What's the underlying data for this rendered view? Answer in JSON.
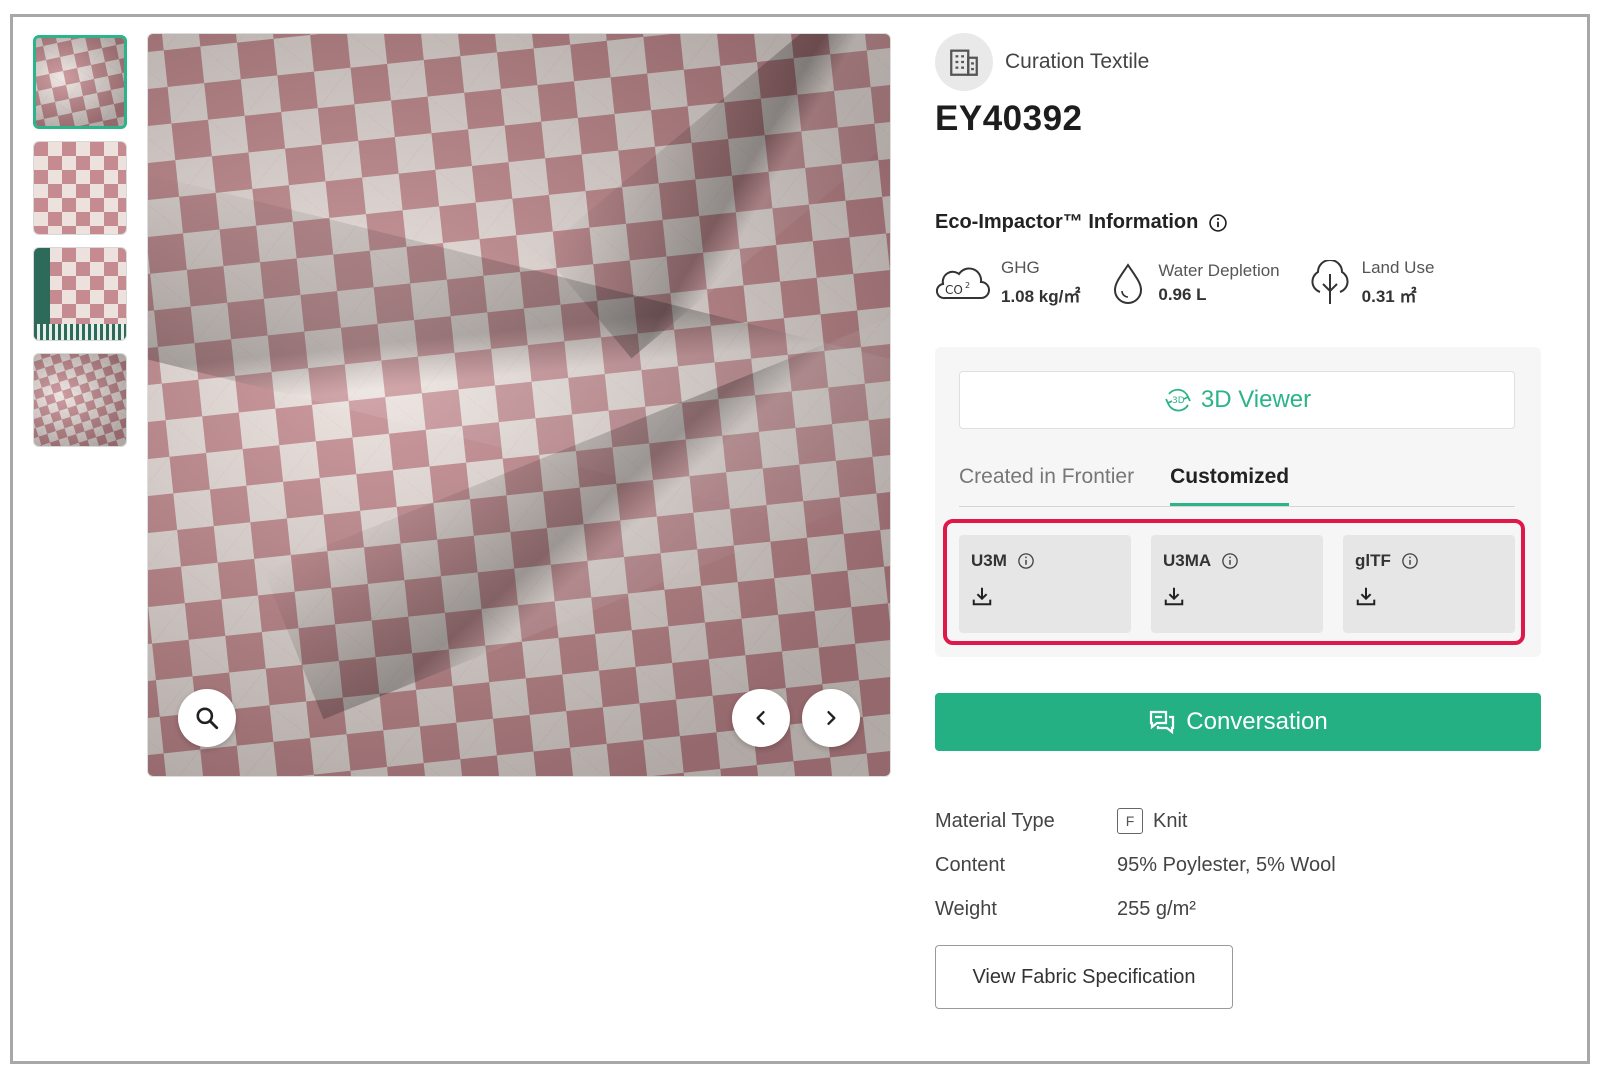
{
  "thumbnails": [
    "thumb-1",
    "thumb-2",
    "thumb-3",
    "thumb-4"
  ],
  "brand": {
    "name": "Curation Textile",
    "icon": "building-icon"
  },
  "product": {
    "code": "EY40392"
  },
  "eco": {
    "title": "Eco-Impactor™ Information",
    "metrics": [
      {
        "icon": "co2-cloud-icon",
        "label": "GHG",
        "value": "1.08 kg/㎡"
      },
      {
        "icon": "water-drop-icon",
        "label": "Water Depletion",
        "value": "0.96 L"
      },
      {
        "icon": "tree-icon",
        "label": "Land Use",
        "value": "0.31 ㎡"
      }
    ]
  },
  "viewer": {
    "label": "3D Viewer"
  },
  "tabs": {
    "created": "Created in Frontier",
    "customized": "Customized",
    "active": "Customized"
  },
  "formats": [
    {
      "name": "U3M"
    },
    {
      "name": "U3MA"
    },
    {
      "name": "glTF"
    }
  ],
  "conversation": {
    "label": "Conversation"
  },
  "specs": {
    "material_type_label": "Material Type",
    "material_type_badge": "F",
    "material_type_value": "Knit",
    "content_label": "Content",
    "content_value": "95% Poylester, 5% Wool",
    "weight_label": "Weight",
    "weight_value": "255 g/m²"
  },
  "spec_button": {
    "label": "View Fabric Specification"
  },
  "colors": {
    "accent": "#24b083",
    "highlight": "#e0184a",
    "fabric_pink": "#c58b90"
  }
}
